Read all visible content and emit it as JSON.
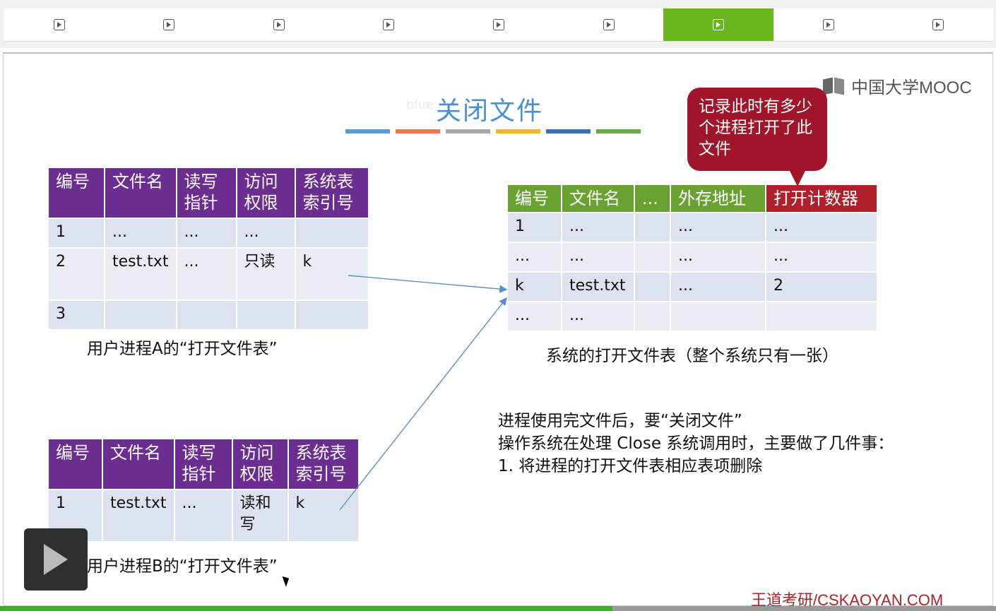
{
  "chapter_bar": {
    "segments": [
      {
        "icon": "play-icon",
        "active": false
      },
      {
        "icon": "play-icon",
        "active": false
      },
      {
        "icon": "play-icon",
        "active": false
      },
      {
        "icon": "play-icon",
        "active": false
      },
      {
        "icon": "play-icon",
        "active": false
      },
      {
        "icon": "play-icon",
        "active": false
      },
      {
        "icon": "play-icon",
        "active": true
      },
      {
        "icon": "play-icon",
        "active": false
      },
      {
        "icon": "play-icon",
        "active": false
      }
    ],
    "active_color": "#6ab61d"
  },
  "slide": {
    "title": "关闭文件",
    "ghost_text": "blue",
    "title_color": "#4a8fd0",
    "underline_colors": [
      "#5b9bd5",
      "#e07b4a",
      "#a6a6a6",
      "#f2b632",
      "#3f6fb6",
      "#6aa84f"
    ],
    "logo_text": "中国大学MOOC",
    "table_a": {
      "headers": [
        "编号",
        "文件名",
        "读写指针",
        "访问权限",
        "系统表索引号"
      ],
      "rows": [
        [
          "1",
          "...",
          "...",
          "...",
          ""
        ],
        [
          "2",
          "test.txt",
          "...",
          "只读",
          "k"
        ],
        [
          "3",
          "",
          "",
          "",
          ""
        ]
      ],
      "caption": "用户进程A的“打开文件表”"
    },
    "table_b": {
      "headers": [
        "编号",
        "文件名",
        "读写指针",
        "访问权限",
        "系统表索引号"
      ],
      "rows": [
        [
          "1",
          "test.txt",
          "...",
          "读和写",
          "k"
        ]
      ],
      "caption": "用户进程B的“打开文件表”"
    },
    "system_table": {
      "headers": [
        "编号",
        "文件名",
        "...",
        "外存地址",
        "打开计数器"
      ],
      "rows": [
        [
          "1",
          "...",
          "",
          "...",
          "..."
        ],
        [
          "...",
          "...",
          "",
          "...",
          "..."
        ],
        [
          "k",
          "test.txt",
          "",
          "...",
          "2"
        ],
        [
          "...",
          "...",
          "",
          "",
          ""
        ]
      ],
      "caption": "系统的打开文件表（整个系统只有一张）"
    },
    "bubble": "记录此时有多少个进程打开了此文件",
    "notes": [
      "进程使用完文件后，要“关闭文件”",
      "操作系统在处理 Close 系统调用时，主要做了几件事：",
      "1.   将进程的打开文件表相应表项删除"
    ],
    "watermark": "王道考研/CSKAOYAN.COM"
  },
  "player": {
    "play_button_icon": "play-icon",
    "progress": 0.615
  }
}
